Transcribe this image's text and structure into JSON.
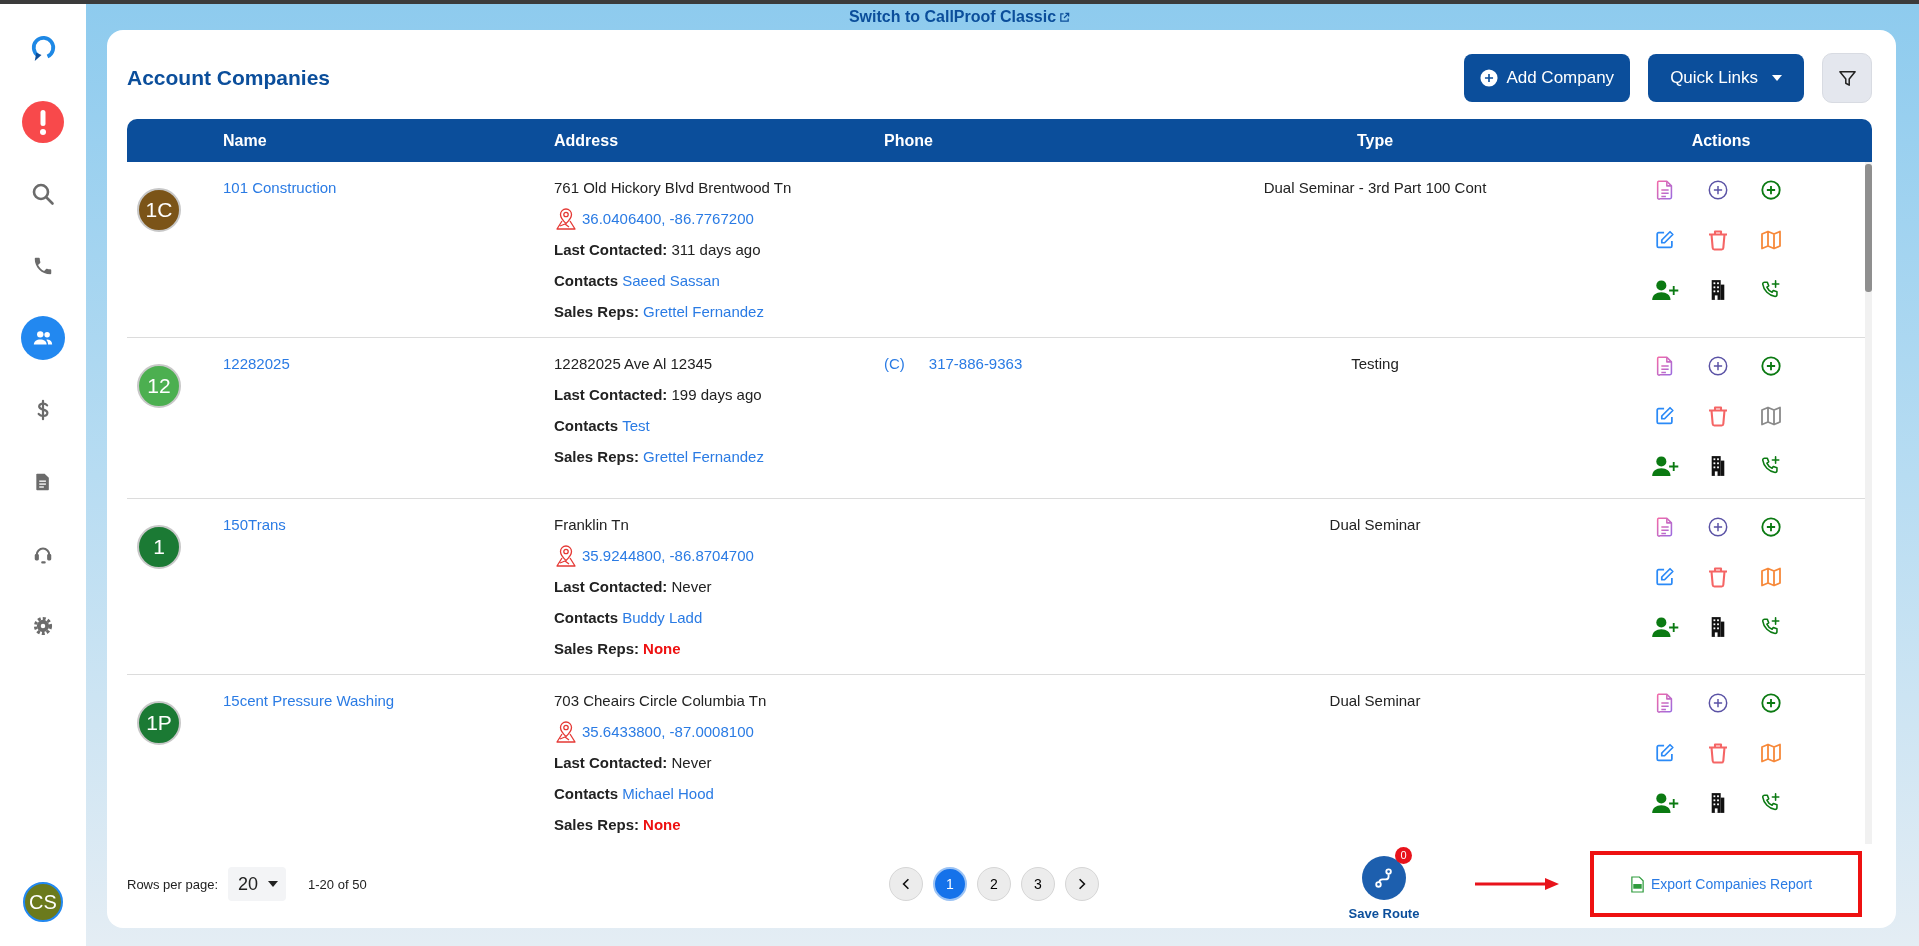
{
  "top_link": {
    "text": "Switch to CallProof Classic"
  },
  "sidebar": {
    "items": [
      {
        "kind": "alert",
        "selected": false
      },
      {
        "kind": "search",
        "selected": false
      },
      {
        "kind": "phone",
        "selected": false
      },
      {
        "kind": "people",
        "selected": true
      },
      {
        "kind": "dollar",
        "selected": false
      },
      {
        "kind": "document",
        "selected": false
      },
      {
        "kind": "headset",
        "selected": false
      },
      {
        "kind": "settings",
        "selected": false
      }
    ],
    "user": {
      "initials": "CS",
      "color": "#6b7a1c"
    }
  },
  "page": {
    "title": "Account Companies",
    "buttons": [
      {
        "kind": "add",
        "label": "Add Company"
      },
      {
        "kind": "menu",
        "label": "Quick Links"
      },
      {
        "kind": "filter"
      }
    ]
  },
  "table": {
    "columns": [
      "Name",
      "Address",
      "Phone",
      "Type",
      "Actions"
    ],
    "rows": [
      {
        "initials": "1C",
        "color": "#7b5418",
        "name": "101 Construction",
        "address": "761 Old Hickory Blvd Brentwood Tn",
        "coordinates": "36.0406400, -86.7767200",
        "last_contacted": {
          "label": "Last Contacted:",
          "value": "311 days ago"
        },
        "contacts": {
          "label": "Contacts",
          "value": "Saeed Sassan"
        },
        "sales_reps": {
          "label": "Sales Reps:",
          "value": "Grettel Fernandez",
          "kind": "link"
        },
        "type": "Dual Seminar - 3rd Part 100 Cont",
        "has_map": true
      },
      {
        "initials": "12",
        "color": "#4caf50",
        "name": "12282025",
        "address": "12282025 Ave Al 12345",
        "phone": {
          "prefix": "(C)",
          "number": "317-886-9363"
        },
        "last_contacted": {
          "label": "Last Contacted:",
          "value": "199 days ago"
        },
        "contacts": {
          "label": "Contacts",
          "value": "Test"
        },
        "sales_reps": {
          "label": "Sales Reps:",
          "value": "Grettel Fernandez",
          "kind": "link"
        },
        "type": "Testing",
        "has_map": false
      },
      {
        "initials": "1",
        "color": "#1b7a34",
        "name": "150Trans",
        "address": "Franklin Tn",
        "coordinates": "35.9244800, -86.8704700",
        "last_contacted": {
          "label": "Last Contacted:",
          "value": "Never"
        },
        "contacts": {
          "label": "Contacts",
          "value": "Buddy Ladd"
        },
        "sales_reps": {
          "label": "Sales Reps:",
          "value": "None",
          "kind": "none"
        },
        "type": "Dual Seminar",
        "has_map": true
      },
      {
        "initials": "1P",
        "color": "#1b7a34",
        "name": "15cent Pressure Washing",
        "address": "703 Cheairs Circle Columbia Tn",
        "coordinates": "35.6433800, -87.0008100",
        "last_contacted": {
          "label": "Last Contacted:",
          "value": "Never"
        },
        "contacts": {
          "label": "Contacts",
          "value": "Michael Hood"
        },
        "sales_reps": {
          "label": "Sales Reps:",
          "value": "None",
          "kind": "none"
        },
        "type": "Dual Seminar",
        "has_map": true
      }
    ]
  },
  "footer": {
    "rows_per_page": {
      "label": "Rows per page:",
      "value": "20"
    },
    "range": "1-20 of 50",
    "pages": [
      {
        "label": "1",
        "selected": true
      },
      {
        "label": "2",
        "selected": false
      },
      {
        "label": "3",
        "selected": false
      }
    ],
    "save_route": {
      "label": "Save Route",
      "badge": "0"
    },
    "export": {
      "label": "Export Companies Report",
      "highlighted": true
    }
  }
}
